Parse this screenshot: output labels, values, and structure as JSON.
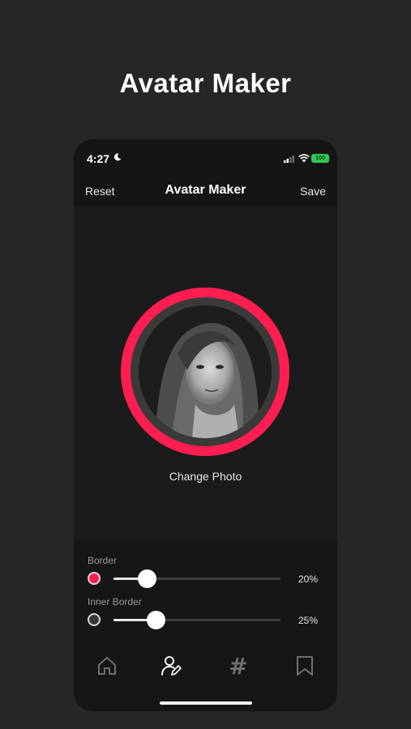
{
  "promo": {
    "title": "Avatar Maker"
  },
  "status": {
    "time": "4:27",
    "battery": "100"
  },
  "nav": {
    "reset_label": "Reset",
    "title": "Avatar Maker",
    "save_label": "Save"
  },
  "avatar": {
    "change_photo_label": "Change Photo",
    "border_color": "#ff1e4f"
  },
  "controls": {
    "border": {
      "label": "Border",
      "value": 0.2,
      "value_text": "20%",
      "swatch_color": "#ff1e4f"
    },
    "inner_border": {
      "label": "Inner Border",
      "value": 0.25,
      "value_text": "25%",
      "swatch_color": "#3a3a3a"
    }
  },
  "tabs": [
    {
      "icon": "home-icon",
      "active": false
    },
    {
      "icon": "user-edit-icon",
      "active": true
    },
    {
      "icon": "hashtag-icon",
      "active": false
    },
    {
      "icon": "bookmark-icon",
      "active": false
    }
  ]
}
